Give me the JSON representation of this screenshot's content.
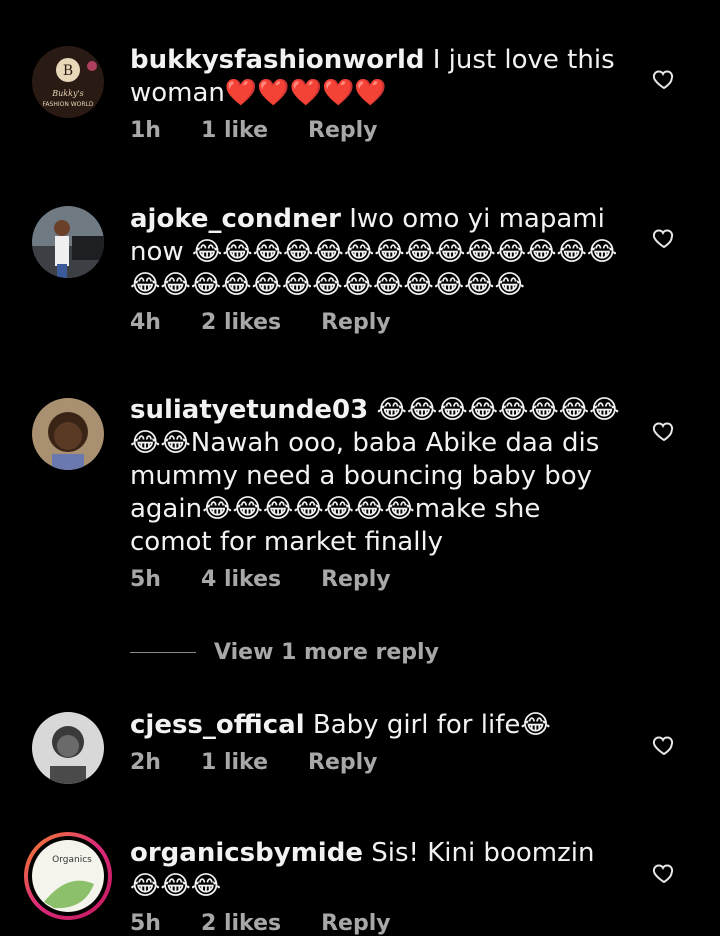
{
  "comments": [
    {
      "username": "bukkysfashionworld",
      "text": "I just love this woman❤️❤️❤️❤️❤️",
      "time": "1h",
      "likes": "1 like",
      "reply": "Reply"
    },
    {
      "username": "ajoke_condner",
      "text": "Iwo omo yi mapami now 😂😂😂😂😂😂😂😂😂😂😂😂😂😂😂😂😂😂😂😂😂😂😂😂😂😂😂",
      "time": "4h",
      "likes": "2 likes",
      "reply": "Reply"
    },
    {
      "username": "suliatyetunde03",
      "text": "😂😂😂😂😂😂😂😂😂😂Nawah ooo, baba Abike daa dis mummy need a bouncing baby boy again😂😂😂😂😂😂😂make she comot for market finally",
      "time": "5h",
      "likes": "4 likes",
      "reply": "Reply"
    },
    {
      "username": "cjess_offical",
      "text": "Baby girl for life😂",
      "time": "2h",
      "likes": "1 like",
      "reply": "Reply"
    },
    {
      "username": "organicsbymide",
      "text": "Sis! Kini boomzin 😂😂😂",
      "time": "5h",
      "likes": "2 likes",
      "reply": "Reply"
    }
  ],
  "view_more_replies": "View 1 more reply",
  "avatar_logo_text": "Organics"
}
